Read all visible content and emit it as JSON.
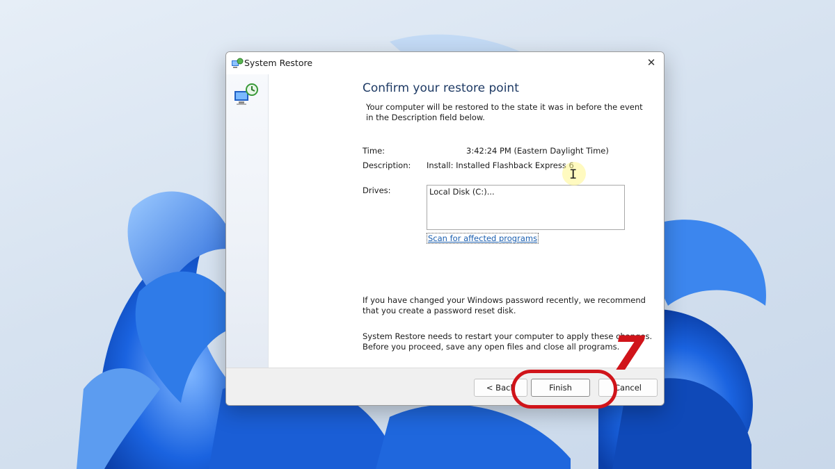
{
  "window": {
    "title": "System Restore",
    "close_symbol": "✕"
  },
  "page": {
    "heading": "Confirm your restore point",
    "intro": "Your computer will be restored to the state it was in before the event in the Description field below."
  },
  "details": {
    "time_label": "Time:",
    "time_value": "3:42:24 PM (Eastern Daylight Time)",
    "description_label": "Description:",
    "description_value": "Install: Installed Flashback Express 6",
    "drives_label": "Drives:",
    "drives_value": "Local Disk (C:)...",
    "scan_link": "Scan for affected programs"
  },
  "notes": {
    "password": "If you have changed your Windows password recently, we recommend that you create a password reset disk.",
    "restart_line1": "System Restore needs to restart your computer to apply these changes.",
    "restart_line2": "Before you proceed, save any open files and close all programs."
  },
  "buttons": {
    "back": "< Back",
    "finish": "Finish",
    "cancel": "Cancel"
  },
  "annotation": {
    "step_number": "7",
    "highlight_color": "#d0141a"
  },
  "icons": {
    "app": "system-restore-icon",
    "side": "system-restore-large-icon",
    "cursor": "text-cursor-icon"
  }
}
